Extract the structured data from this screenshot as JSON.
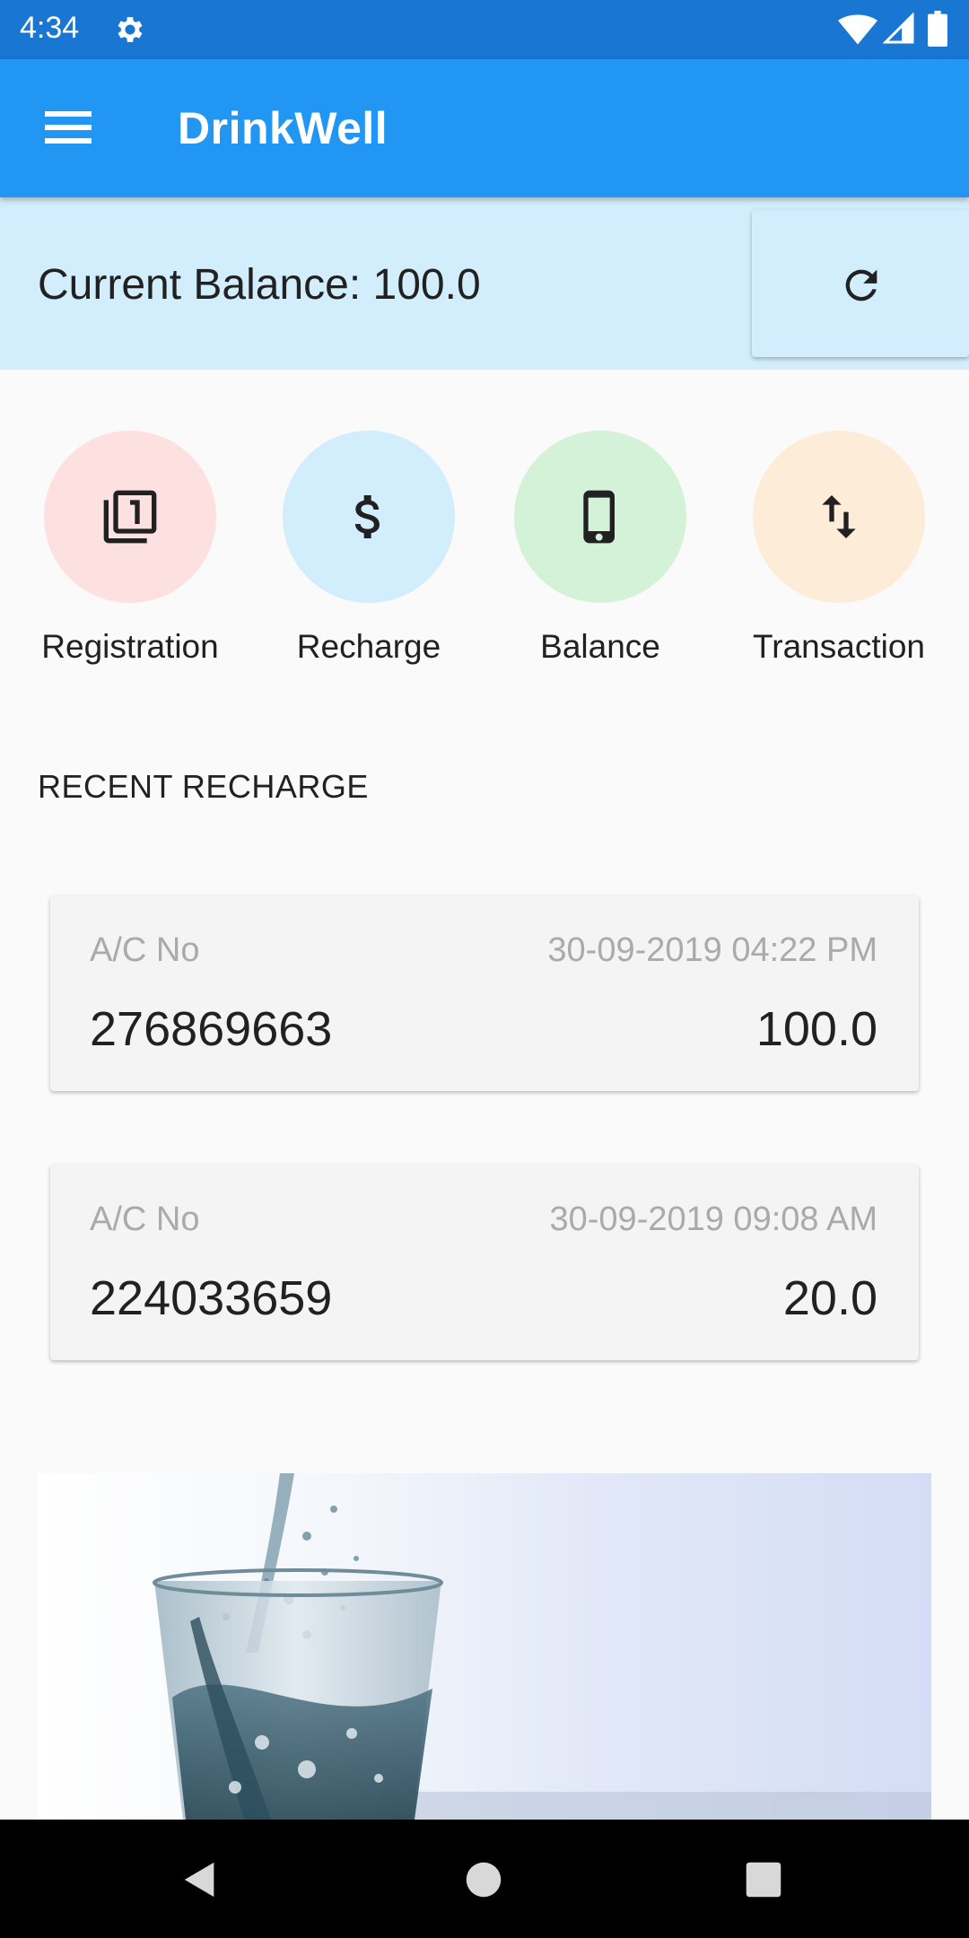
{
  "status_bar": {
    "time": "4:34",
    "icons": [
      "settings-gear-icon",
      "wifi-icon",
      "cell-signal-icon",
      "battery-icon"
    ]
  },
  "app_bar": {
    "title": "DrinkWell",
    "menu_icon": "hamburger-menu-icon",
    "color": "#2196f3"
  },
  "balance": {
    "text": "Current Balance: 100.0",
    "refresh_icon": "refresh-icon",
    "background": "#d2edfb"
  },
  "actions": [
    {
      "label": "Registration",
      "icon": "filter-1-icon",
      "color": "#fde0e0"
    },
    {
      "label": "Recharge",
      "icon": "dollar-icon",
      "color": "#d2edfb"
    },
    {
      "label": "Balance",
      "icon": "phone-icon",
      "color": "#d4f2d8"
    },
    {
      "label": "Transaction",
      "icon": "swap-vert-icon",
      "color": "#fdecd8"
    }
  ],
  "recent_recharge": {
    "heading": "RECENT RECHARGE",
    "items": [
      {
        "ac_label": "A/C No",
        "date": "30-09-2019 04:22 PM",
        "account": "276869663",
        "amount": "100.0"
      },
      {
        "ac_label": "A/C No",
        "date": "30-09-2019 09:08 AM",
        "account": "224033659",
        "amount": "20.0"
      }
    ]
  },
  "banner": {
    "image": "water-glass-splash-image"
  },
  "nav_bar": {
    "icons": [
      "back-icon",
      "home-icon",
      "recents-icon"
    ]
  }
}
